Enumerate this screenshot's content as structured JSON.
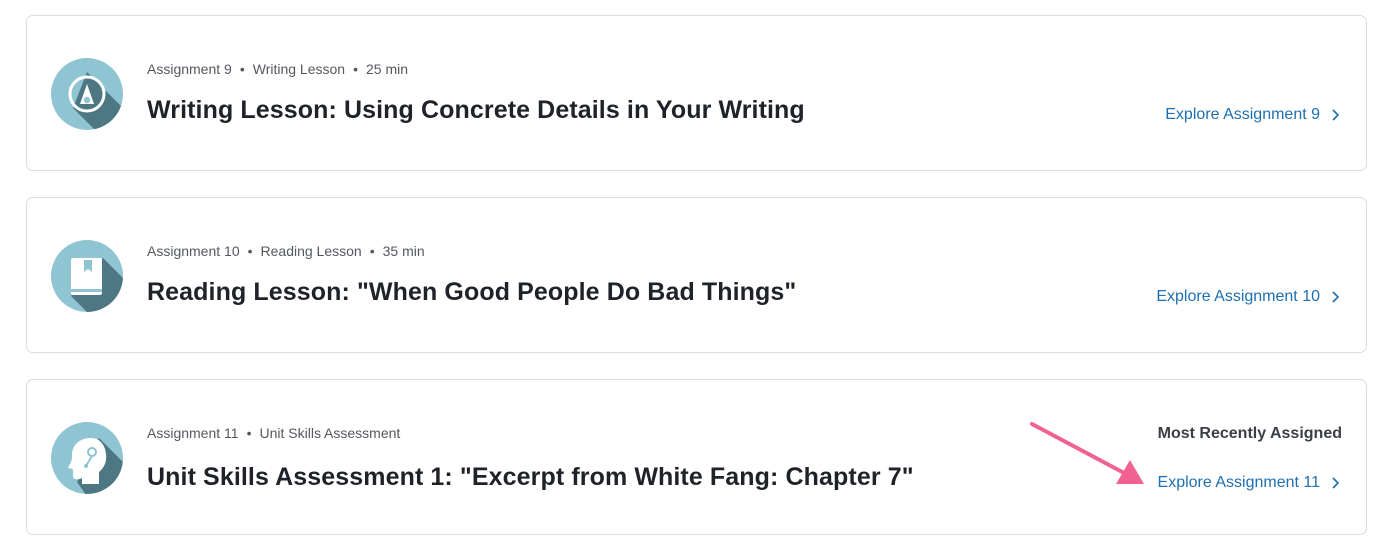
{
  "assignments": [
    {
      "number": "Assignment 9",
      "type": "Writing Lesson",
      "duration": "25 min",
      "title": "Writing Lesson: Using Concrete Details in Your Writing",
      "link": "Explore Assignment 9",
      "icon": "writing-lesson-icon"
    },
    {
      "number": "Assignment 10",
      "type": "Reading Lesson",
      "duration": "35 min",
      "title": "Reading Lesson: \"When Good People Do Bad Things\"",
      "link": "Explore Assignment 10",
      "icon": "reading-lesson-icon"
    },
    {
      "number": "Assignment 11",
      "type": "Unit Skills Assessment",
      "title": "Unit Skills Assessment 1: \"Excerpt from White Fang: Chapter 7\"",
      "link": "Explore Assignment 11",
      "badge": "Most Recently Assigned",
      "icon": "skills-assessment-icon"
    }
  ],
  "colors": {
    "icon_bg": "#8fc5d2",
    "icon_shadow": "#4d7782",
    "link": "#1e6fb0",
    "annotation_arrow": "#f06292"
  },
  "separator": "•"
}
